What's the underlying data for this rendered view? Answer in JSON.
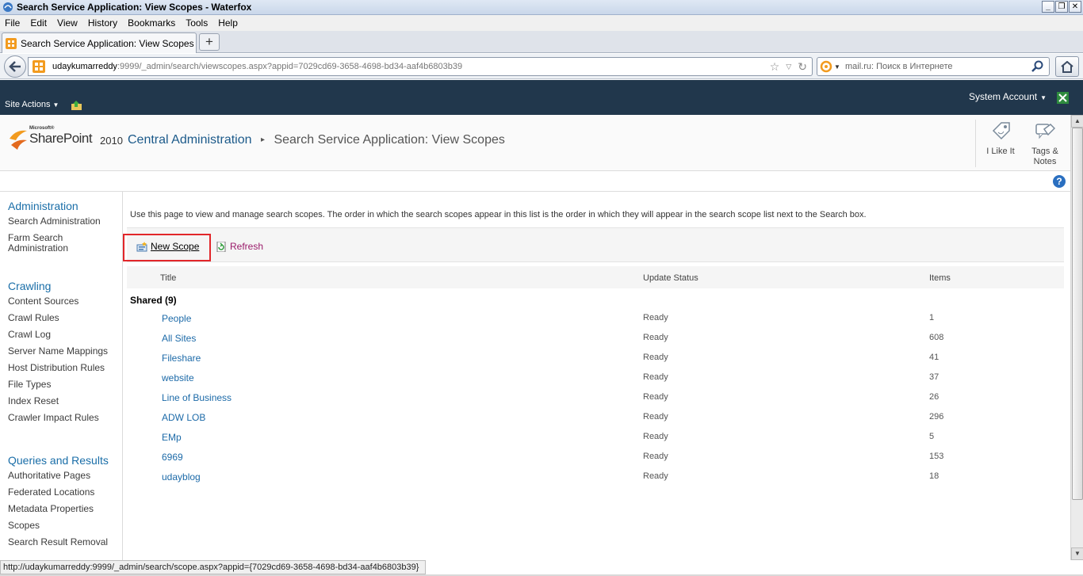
{
  "window": {
    "title": "Search Service Application: View Scopes - Waterfox"
  },
  "menu": [
    "File",
    "Edit",
    "View",
    "History",
    "Bookmarks",
    "Tools",
    "Help"
  ],
  "tab": {
    "label": "Search Service Application: View Scopes"
  },
  "address": {
    "host": "udaykumarreddy",
    "rest": ":9999/_admin/search/viewscopes.aspx?appid=7029cd69-3658-4698-bd34-aaf4b6803b39"
  },
  "search": {
    "placeholder": "mail.ru: Поиск в Интернете"
  },
  "ribbon": {
    "site_actions": "Site Actions",
    "account": "System Account"
  },
  "brand": {
    "microsoft": "Microsoft®",
    "sharepoint": "SharePoint",
    "version": "2010"
  },
  "breadcrumb": {
    "root": "Central Administration",
    "current": "Search Service Application: View Scopes"
  },
  "social": {
    "like": "I Like It",
    "tags_line1": "Tags &",
    "tags_line2": "Notes"
  },
  "leftnav": {
    "administration": {
      "heading": "Administration",
      "items": [
        "Search Administration",
        "Farm Search",
        "Administration"
      ]
    },
    "crawling": {
      "heading": "Crawling",
      "items": [
        "Content Sources",
        "Crawl Rules",
        "Crawl Log",
        "Server Name Mappings",
        "Host Distribution Rules",
        "File Types",
        "Index Reset",
        "Crawler Impact Rules"
      ]
    },
    "queries": {
      "heading": "Queries and Results",
      "items": [
        "Authoritative Pages",
        "Federated Locations",
        "Metadata Properties",
        "Scopes",
        "Search Result Removal"
      ]
    }
  },
  "main": {
    "intro": "Use this page to view and manage search scopes. The order in which the search scopes appear in this list is the order in which they will appear in the search scope list next to the Search box.",
    "toolbar": {
      "new_scope": "New Scope",
      "refresh": "Refresh"
    },
    "columns": {
      "title": "Title",
      "status": "Update Status",
      "items": "Items"
    },
    "group": "Shared (9)",
    "rows": [
      {
        "title": "People",
        "status": "Ready",
        "items": "1"
      },
      {
        "title": "All Sites",
        "status": "Ready",
        "items": "608"
      },
      {
        "title": "Fileshare",
        "status": "Ready",
        "items": "41"
      },
      {
        "title": "website",
        "status": "Ready",
        "items": "37"
      },
      {
        "title": "Line of Business",
        "status": "Ready",
        "items": "26"
      },
      {
        "title": "ADW LOB",
        "status": "Ready",
        "items": "296"
      },
      {
        "title": "EMp",
        "status": "Ready",
        "items": "5"
      },
      {
        "title": "6969",
        "status": "Ready",
        "items": "153"
      },
      {
        "title": "udayblog",
        "status": "Ready",
        "items": "18"
      }
    ]
  },
  "statusbar": {
    "text": "http://udaykumarreddy:9999/_admin/search/scope.aspx?appid={7029cd69-3658-4698-bd34-aaf4b6803b39}"
  },
  "colors": {
    "ribbon": "#21374c",
    "link": "#1c6aa8",
    "highlight": "#e2262a",
    "refresh": "#9a1b6a"
  }
}
